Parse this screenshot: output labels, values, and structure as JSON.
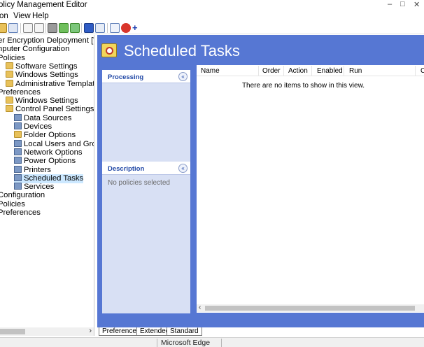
{
  "window": {
    "title": "olicy Management Editor",
    "minimize": "–",
    "restore": "□",
    "close": "✕"
  },
  "menu": {
    "action": "on",
    "view": "View",
    "help": "Help"
  },
  "toolbar": {
    "icons": [
      "back-icon",
      "forward-icon",
      "folder-icon",
      "console-tree-icon",
      "copy-icon",
      "paste-icon",
      "print-icon",
      "refresh-icon",
      "export-icon",
      "help-icon",
      "properties-icon",
      "new-icon",
      "delete-icon",
      "add-icon"
    ]
  },
  "tree": {
    "items": [
      {
        "label": "er Encryption Delpoyment [WIN-MBS",
        "indent": 0,
        "icon": "none"
      },
      {
        "label": "nputer Configuration",
        "indent": 0,
        "icon": "none"
      },
      {
        "label": "Policies",
        "indent": 0,
        "icon": "none"
      },
      {
        "label": "Software Settings",
        "indent": 1,
        "icon": "folder"
      },
      {
        "label": "Windows Settings",
        "indent": 1,
        "icon": "folder"
      },
      {
        "label": "Administrative Templates: Policy d",
        "indent": 1,
        "icon": "folder"
      },
      {
        "label": "Preferences",
        "indent": 0,
        "icon": "none"
      },
      {
        "label": "Windows Settings",
        "indent": 1,
        "icon": "folder"
      },
      {
        "label": "Control Panel Settings",
        "indent": 1,
        "icon": "folder"
      },
      {
        "label": "Data Sources",
        "indent": 2,
        "icon": "cp"
      },
      {
        "label": "Devices",
        "indent": 2,
        "icon": "cp"
      },
      {
        "label": "Folder Options",
        "indent": 2,
        "icon": "folder"
      },
      {
        "label": "Local Users and Groups",
        "indent": 2,
        "icon": "cp"
      },
      {
        "label": "Network Options",
        "indent": 2,
        "icon": "cp"
      },
      {
        "label": "Power Options",
        "indent": 2,
        "icon": "cp"
      },
      {
        "label": "Printers",
        "indent": 2,
        "icon": "cp"
      },
      {
        "label": "Scheduled Tasks",
        "indent": 2,
        "icon": "cp",
        "selected": true
      },
      {
        "label": "Services",
        "indent": 2,
        "icon": "cp"
      },
      {
        "label": "Configuration",
        "indent": 0,
        "icon": "none"
      },
      {
        "label": "Policies",
        "indent": 0,
        "icon": "none"
      },
      {
        "label": "Preferences",
        "indent": 0,
        "icon": "none"
      }
    ]
  },
  "right": {
    "title": "Scheduled Tasks",
    "processing_panel": {
      "title": "Processing",
      "chevron": "«"
    },
    "description_panel": {
      "title": "Description",
      "chevron": "«",
      "text": "No policies selected"
    },
    "columns": [
      "Name",
      "Order",
      "Action",
      "Enabled",
      "Run",
      "C"
    ],
    "empty_text": "There are no items to show in this view."
  },
  "tabs": [
    "Preferences",
    "Extended",
    "Standard"
  ],
  "status": {
    "left": "",
    "middle": "Microsoft Edge"
  },
  "colors": {
    "header_blue": "#5677d3",
    "panel_bg": "#d8e0f4",
    "panel_title": "#2148a6",
    "selected_bg": "#cce8ff"
  }
}
